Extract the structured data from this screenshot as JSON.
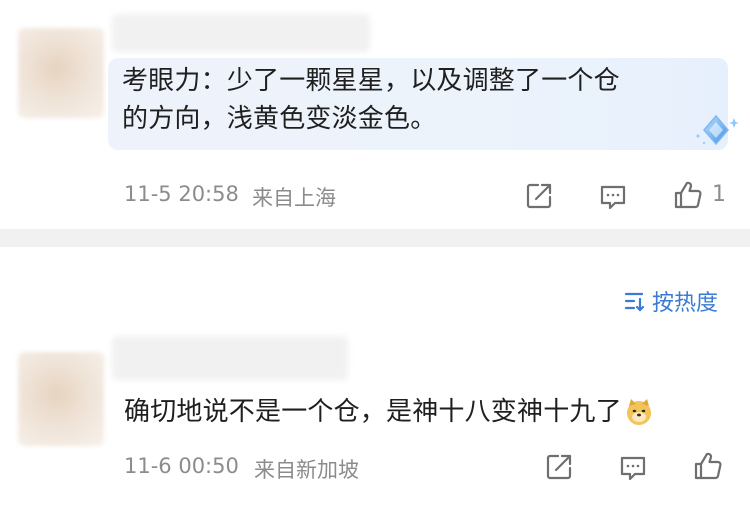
{
  "comments": [
    {
      "text_line1": "考眼力：少了一颗星星，以及调整了一个仓",
      "text_line2": "的方向，浅黄色变淡金色。",
      "time": "11-5 20:58",
      "location": "来自上海",
      "like_count": "1"
    },
    {
      "text": "确切地说不是一个仓，是神十八变神十九了",
      "emoji": "doge",
      "time": "11-6 00:50",
      "location": "来自新加坡"
    }
  ],
  "sort": {
    "label": "按热度",
    "icon": "sort-lines-icon"
  },
  "colors": {
    "accent": "#3a7bd5",
    "meta": "#8c8c8c",
    "divider": "#f1f1f1",
    "bubble": "#eef3fb"
  },
  "icons": {
    "share": "share-square-arrow-icon",
    "comment": "comment-bubble-icon",
    "like": "thumbs-up-icon",
    "badge": "diamond-sparkle-icon"
  }
}
